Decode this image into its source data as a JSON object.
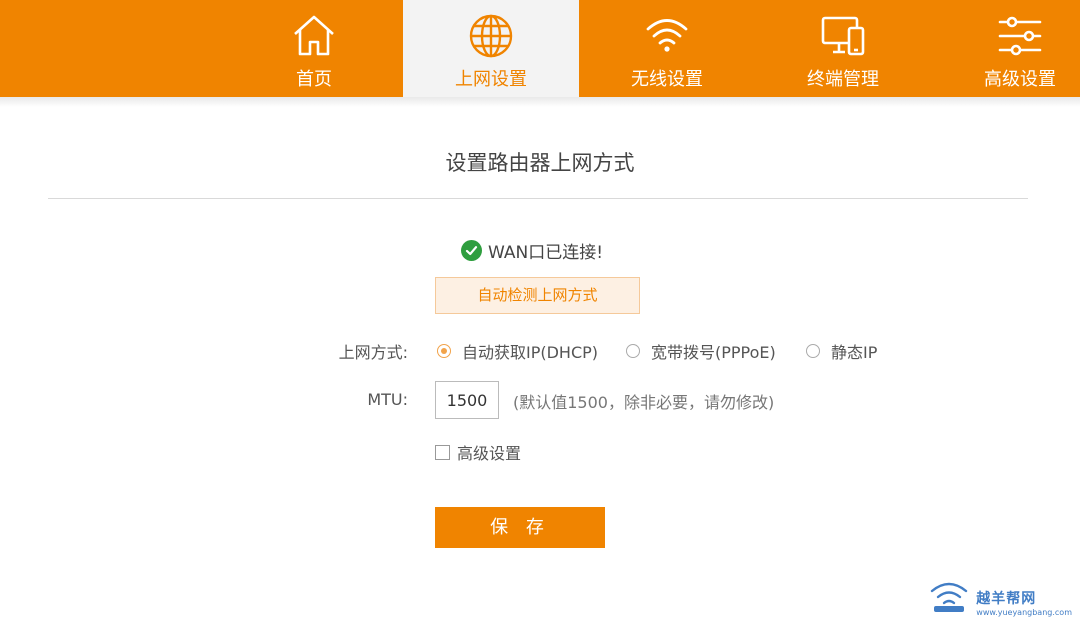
{
  "nav": {
    "tabs": [
      {
        "label": "首页",
        "icon": "home-icon",
        "active": false
      },
      {
        "label": "上网设置",
        "icon": "globe-icon",
        "active": true
      },
      {
        "label": "无线设置",
        "icon": "wifi-icon",
        "active": false
      },
      {
        "label": "终端管理",
        "icon": "devices-icon",
        "active": false
      },
      {
        "label": "高级设置",
        "icon": "sliders-icon",
        "active": false
      }
    ]
  },
  "colors": {
    "accent": "#f08400",
    "active_tab_bg": "#f3f3f3",
    "status_ok": "#2f9e3f"
  },
  "main": {
    "title": "设置路由器上网方式",
    "status_text": "WAN口已连接!",
    "detect_button": "自动检测上网方式",
    "connection_type": {
      "label": "上网方式:",
      "options": [
        {
          "label": "自动获取IP(DHCP)",
          "selected": true
        },
        {
          "label": "宽带拨号(PPPoE)",
          "selected": false
        },
        {
          "label": "静态IP",
          "selected": false
        }
      ]
    },
    "mtu": {
      "label": "MTU:",
      "value": "1500",
      "hint": "(默认值1500，除非必要，请勿修改)"
    },
    "advanced_checkbox": {
      "label": "高级设置",
      "checked": false
    },
    "save_button": "保 存"
  },
  "watermark": {
    "name": "越羊帮网",
    "url": "www.yueyangbang.com"
  }
}
